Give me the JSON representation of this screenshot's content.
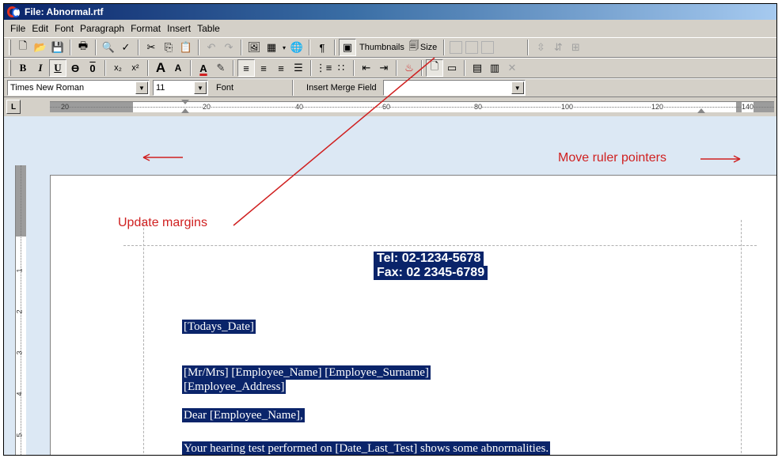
{
  "window": {
    "title": "File: Abnormal.rtf"
  },
  "menu": [
    "File",
    "Edit",
    "Font",
    "Paragraph",
    "Format",
    "Insert",
    "Table"
  ],
  "toolbar1": {
    "thumbnails_label": "Thumbnails",
    "size_label": "Size"
  },
  "toolbar3": {
    "font_name": "Times New Roman",
    "font_size": "11",
    "font_button": "Font",
    "merge_field_label": "Insert Merge Field",
    "merge_field_value": ""
  },
  "ruler": {
    "tab_button": "L",
    "labels": [
      "20",
      "20",
      "40",
      "60",
      "80",
      "100",
      "120",
      "140"
    ]
  },
  "vruler": {
    "labels": [
      "1",
      "2",
      "3",
      "4",
      "5"
    ]
  },
  "document": {
    "tel": "Tel: 02-1234-5678",
    "fax": "Fax: 02 2345-6789",
    "date_field": "[Todays_Date]",
    "name_line": "[Mr/Mrs] [Employee_Name] [Employee_Surname]",
    "address_line": "[Employee_Address]",
    "greeting": "Dear [Employee_Name],",
    "body_line": "Your hearing test performed on [Date_Last_Test] shows some  abnormalities."
  },
  "annotations": {
    "update_margins": "Update margins",
    "move_ruler": "Move ruler pointers"
  },
  "colors": {
    "highlight": "#0a246a",
    "annotation": "#d02020",
    "workspace": "#dce8f4"
  }
}
